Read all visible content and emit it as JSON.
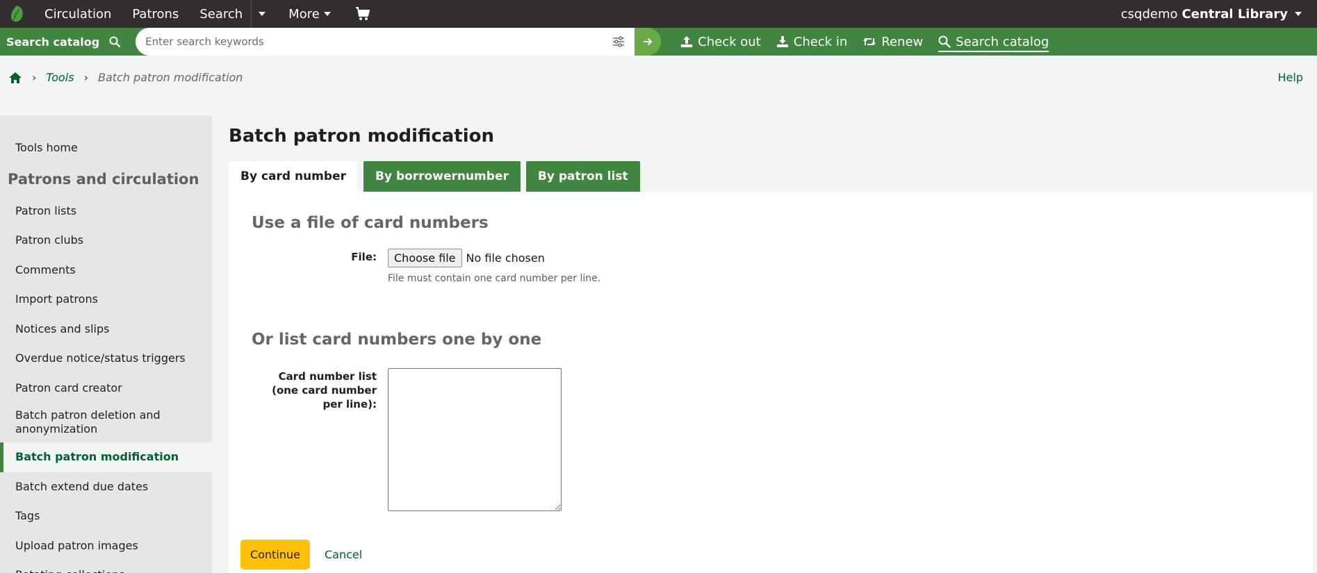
{
  "topnav": {
    "circulation": "Circulation",
    "patrons": "Patrons",
    "search": "Search",
    "more": "More",
    "user": "csqdemo",
    "library": "Central Library"
  },
  "searchbar": {
    "label": "Search catalog",
    "placeholder": "Enter search keywords",
    "actions": {
      "checkout": "Check out",
      "checkin": "Check in",
      "renew": "Renew",
      "search_catalog": "Search catalog"
    }
  },
  "breadcrumbs": {
    "tools": "Tools",
    "current": "Batch patron modification",
    "help": "Help"
  },
  "sidebar": {
    "tools_home": "Tools home",
    "heading": "Patrons and circulation",
    "items": [
      "Patron lists",
      "Patron clubs",
      "Comments",
      "Import patrons",
      "Notices and slips",
      "Overdue notice/status triggers",
      "Patron card creator",
      "Batch patron deletion and anonymization",
      "Batch patron modification",
      "Batch extend due dates",
      "Tags",
      "Upload patron images",
      "Rotating collections"
    ]
  },
  "main": {
    "title": "Batch patron modification",
    "tabs": [
      "By card number",
      "By borrowernumber",
      "By patron list"
    ],
    "file_section": {
      "title": "Use a file of card numbers",
      "label": "File:",
      "button": "Choose file",
      "status": "No file chosen",
      "hint": "File must contain one card number per line."
    },
    "list_section": {
      "title": "Or list card numbers one by one",
      "label": "Card number list (one card number per line):",
      "value": ""
    },
    "continue": "Continue",
    "cancel": "Cancel"
  },
  "colors": {
    "topnav_bg": "#322d2e",
    "brand_green": "#408540",
    "link_green": "#00622d",
    "continue_yellow": "#ffc107"
  }
}
